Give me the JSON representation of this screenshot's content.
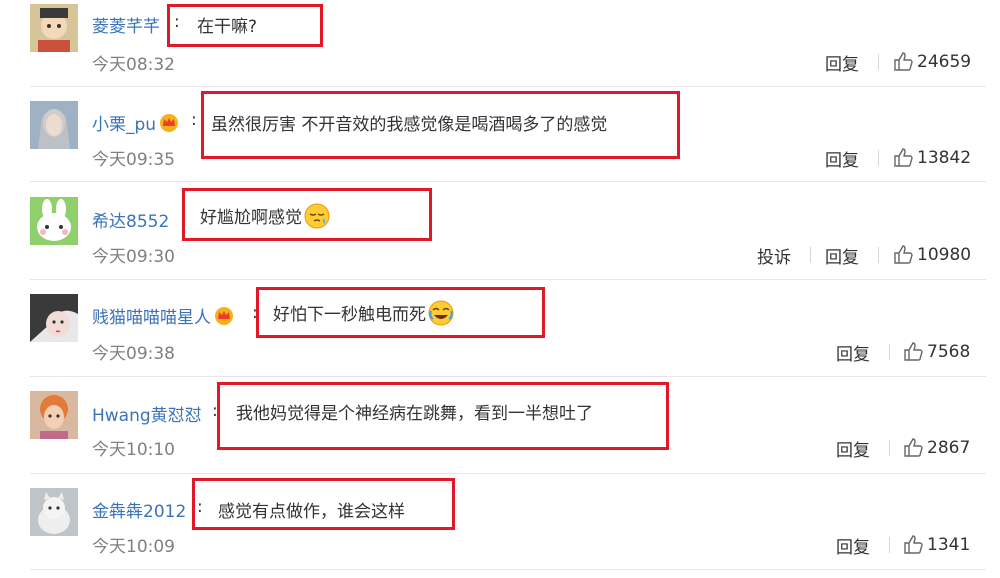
{
  "comments": [
    {
      "username": "菱菱芊芊",
      "colon": ":",
      "text": "在干嘛?",
      "time": "今天08:32",
      "reply": "回复",
      "likes": "24659"
    },
    {
      "username": "小栗_pu",
      "colon": ":",
      "text": "虽然很厉害 不开音效的我感觉像是喝酒喝多了的感觉",
      "time": "今天09:35",
      "reply": "回复",
      "likes": "13842"
    },
    {
      "username": "希达8552",
      "colon": ":",
      "text": "好尴尬啊感觉",
      "time": "今天09:30",
      "report": "投诉",
      "reply": "回复",
      "likes": "10980"
    },
    {
      "username": "贱猫喵喵喵星人",
      "colon": ":",
      "text": "好怕下一秒触电而死",
      "time": "今天09:38",
      "reply": "回复",
      "likes": "7568"
    },
    {
      "username": "Hwang黄怼怼",
      "colon": ":",
      "text": "我他妈觉得是个神经病在跳舞，看到一半想吐了",
      "time": "今天10:10",
      "reply": "回复",
      "likes": "2867"
    },
    {
      "username": "金犇犇2012",
      "colon": ":",
      "text": "感觉有点做作，谁会这样",
      "time": "今天10:09",
      "reply": "回复",
      "likes": "1341"
    }
  ],
  "colors": {
    "username": "#3b73b9",
    "highlight_box": "#e0182a",
    "timestamp": "#808080"
  }
}
